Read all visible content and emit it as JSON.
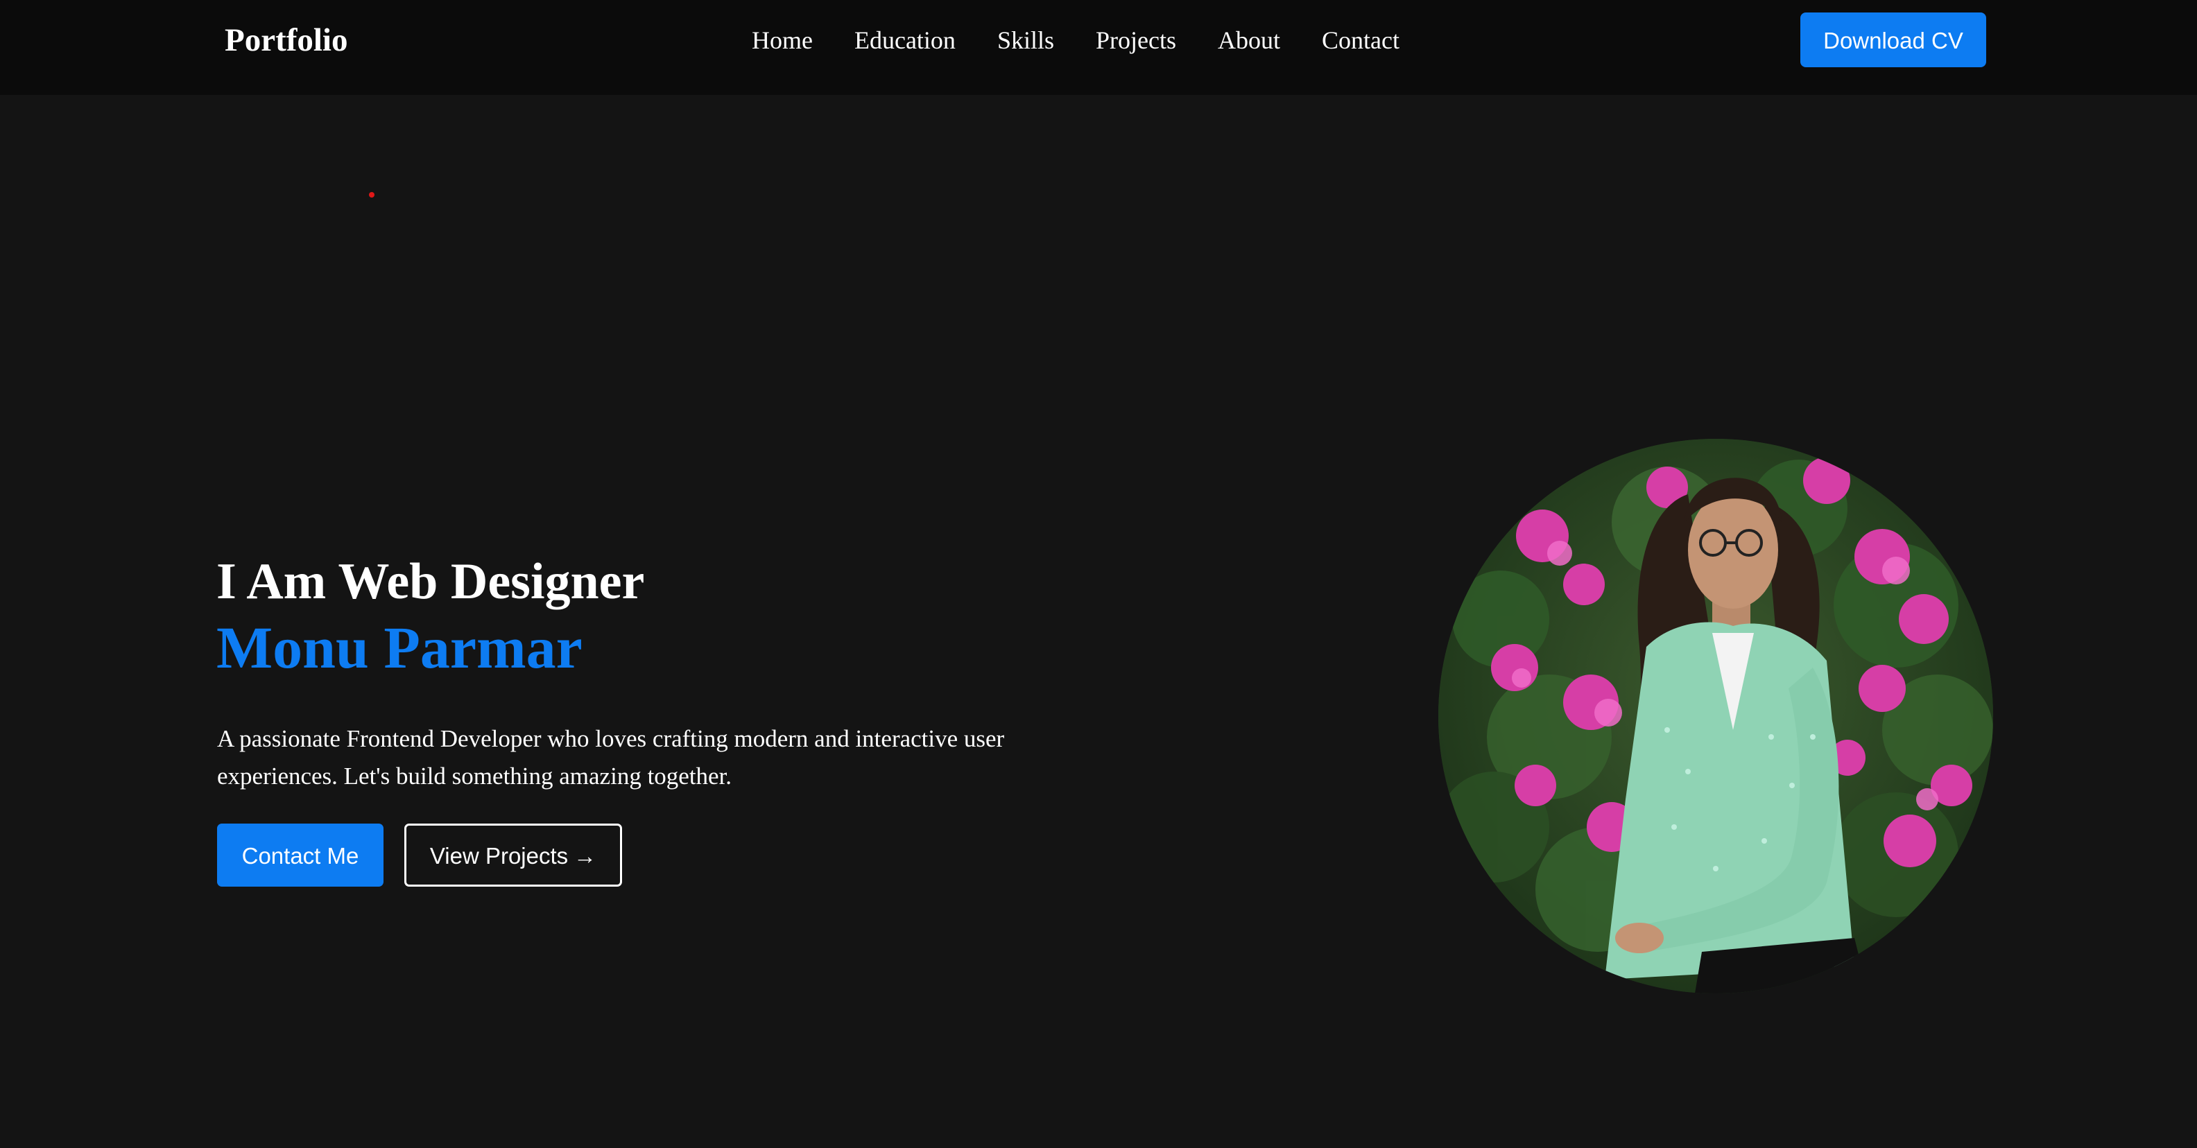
{
  "nav": {
    "brand": "Portfolio",
    "links": [
      {
        "label": "Home"
      },
      {
        "label": "Education"
      },
      {
        "label": "Skills"
      },
      {
        "label": "Projects"
      },
      {
        "label": "About"
      },
      {
        "label": "Contact"
      }
    ],
    "cta_label": "Download CV"
  },
  "hero": {
    "intro": "I Am Web Designer",
    "name": "Monu Parmar",
    "description": "A passionate Frontend Developer who loves crafting modern and interactive user experiences. Let's build something amazing together.",
    "primary_button": "Contact Me",
    "secondary_button": "View Projects",
    "secondary_button_arrow": "→"
  },
  "colors": {
    "accent": "#0d7cf2",
    "background": "#141414",
    "navbar": "#0b0b0b",
    "dot": "#e01818"
  },
  "icons": {
    "arrow": "arrow-right-icon"
  }
}
